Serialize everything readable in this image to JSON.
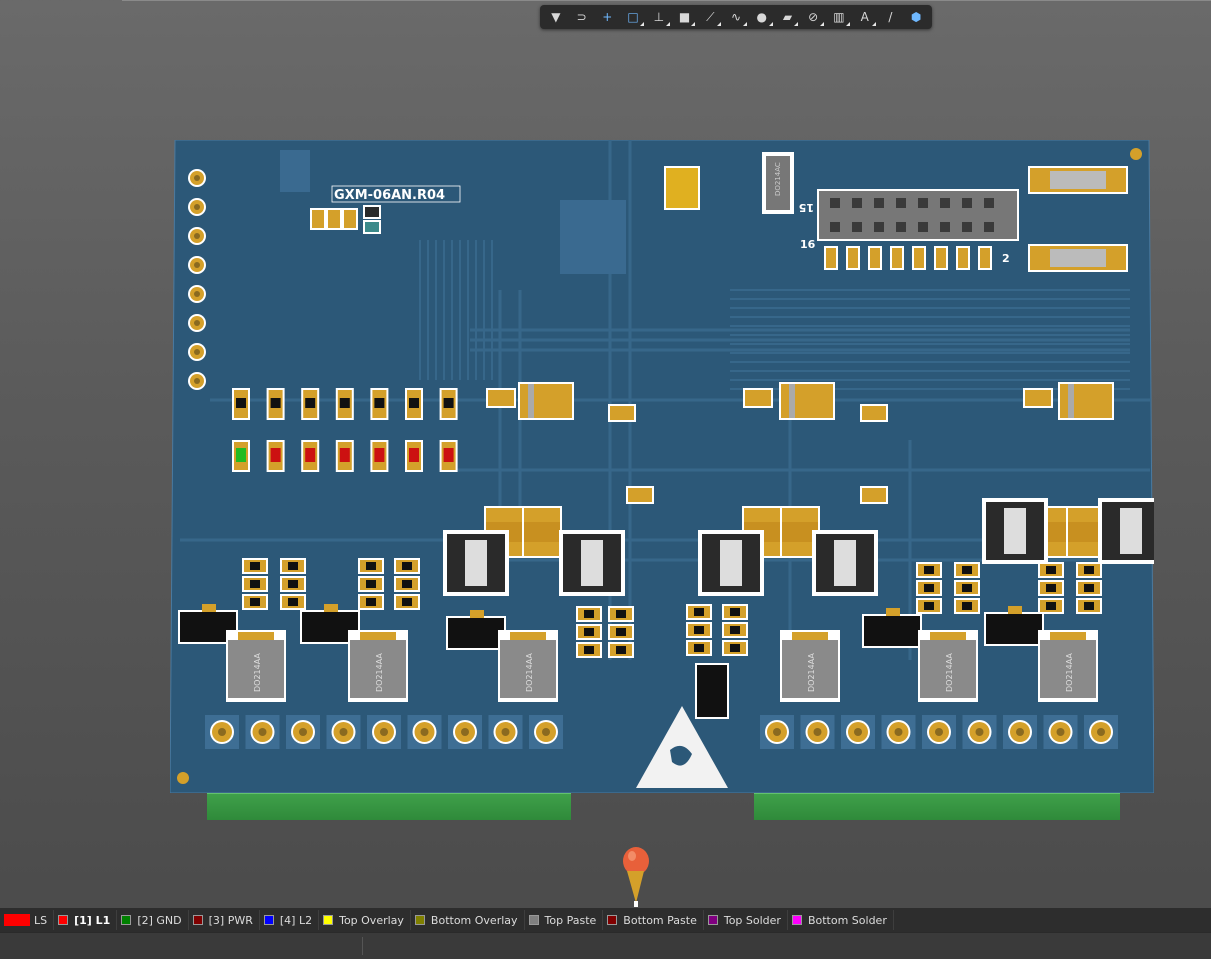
{
  "toolbar": {
    "tools": [
      {
        "name": "filter-icon",
        "glyph": "▼",
        "arrow": false,
        "active": false
      },
      {
        "name": "magnet-icon",
        "glyph": "⊃",
        "arrow": false,
        "active": false
      },
      {
        "name": "crosshair-icon",
        "glyph": "+",
        "arrow": false,
        "active": true
      },
      {
        "name": "select-rect-icon",
        "glyph": "□",
        "arrow": true,
        "active": true
      },
      {
        "name": "align-icon",
        "glyph": "⊥",
        "arrow": true,
        "active": false
      },
      {
        "name": "component-icon",
        "glyph": "■",
        "arrow": true,
        "active": false
      },
      {
        "name": "route-icon",
        "glyph": "⟋",
        "arrow": true,
        "active": false
      },
      {
        "name": "diff-pair-icon",
        "glyph": "∿",
        "arrow": true,
        "active": false
      },
      {
        "name": "via-icon",
        "glyph": "●",
        "arrow": true,
        "active": false
      },
      {
        "name": "polygon-icon",
        "glyph": "▰",
        "arrow": true,
        "active": false
      },
      {
        "name": "region-icon",
        "glyph": "⊘",
        "arrow": true,
        "active": false
      },
      {
        "name": "chart-icon",
        "glyph": "▥",
        "arrow": true,
        "active": false
      },
      {
        "name": "text-icon",
        "glyph": "A",
        "arrow": true,
        "active": false
      },
      {
        "name": "line-icon",
        "glyph": "/",
        "arrow": false,
        "active": false
      },
      {
        "name": "3d-body-icon",
        "glyph": "⬢",
        "arrow": false,
        "active": true
      }
    ]
  },
  "board": {
    "silkscreen_title": "GXM-06AN.R04",
    "connector_labels": [
      "15",
      "16",
      "2"
    ],
    "inductor_label": "DO214AA",
    "diode_label": "DO214AC"
  },
  "layers": [
    {
      "label": "LS",
      "color": "#ff0000",
      "big": true,
      "active": false
    },
    {
      "label": "[1] L1",
      "color": "#ff0000",
      "big": false,
      "active": true
    },
    {
      "label": "[2] GND",
      "color": "#008000",
      "big": false,
      "active": false
    },
    {
      "label": "[3] PWR",
      "color": "#800000",
      "big": false,
      "active": false
    },
    {
      "label": "[4] L2",
      "color": "#0000ff",
      "big": false,
      "active": false
    },
    {
      "label": "Top Overlay",
      "color": "#ffff00",
      "big": false,
      "active": false
    },
    {
      "label": "Bottom Overlay",
      "color": "#808000",
      "big": false,
      "active": false
    },
    {
      "label": "Top Paste",
      "color": "#808080",
      "big": false,
      "active": false
    },
    {
      "label": "Bottom Paste",
      "color": "#800000",
      "big": false,
      "active": false
    },
    {
      "label": "Top Solder",
      "color": "#800080",
      "big": false,
      "active": false
    },
    {
      "label": "Bottom Solder",
      "color": "#ff00ff",
      "big": false,
      "active": false
    }
  ],
  "colors": {
    "board": "#2c5878",
    "pad": "#d4a02a",
    "silk": "#ffffff",
    "connector": "#3fa04a",
    "background": "#5c5c5c"
  }
}
